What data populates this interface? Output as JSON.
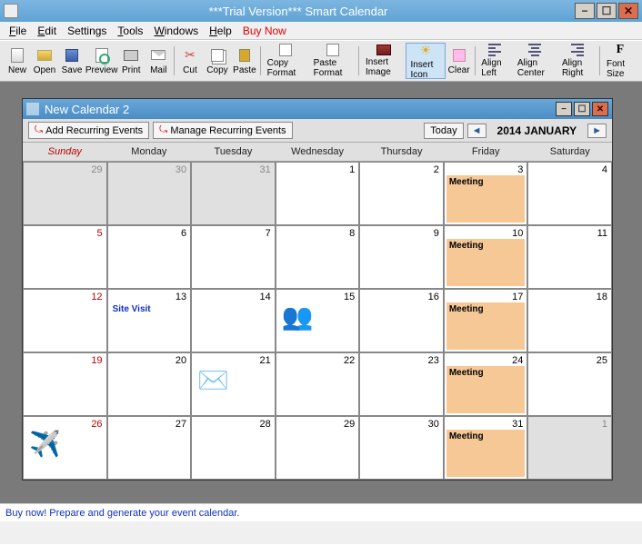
{
  "window": {
    "title": "***Trial Version*** Smart Calendar",
    "min": "−",
    "max": "☐",
    "close": "✕"
  },
  "menu": {
    "file": "File",
    "edit": "Edit",
    "settings": "Settings",
    "tools": "Tools",
    "windows": "Windows",
    "help": "Help",
    "buy": "Buy Now"
  },
  "toolbar": {
    "new": "New",
    "open": "Open",
    "save": "Save",
    "preview": "Preview",
    "print": "Print",
    "mail": "Mail",
    "cut": "Cut",
    "copy": "Copy",
    "paste": "Paste",
    "copyf": "Copy Format",
    "pastef": "Paste Format",
    "insimg": "Insert Image",
    "insicon": "Insert Icon",
    "clear": "Clear",
    "aleft": "Align Left",
    "acenter": "Align Center",
    "aright": "Align Right",
    "fsize": "Font Size"
  },
  "doc": {
    "title": "New Calendar 2",
    "min": "−",
    "max": "☐",
    "close": "✕"
  },
  "cal": {
    "addrec": "Add Recurring Events",
    "managerec": "Manage Recurring Events",
    "today": "Today",
    "prev": "◄",
    "next": "►",
    "month": "2014 JANUARY",
    "days": {
      "sun": "Sunday",
      "mon": "Monday",
      "tue": "Tuesday",
      "wed": "Wednesday",
      "thu": "Thursday",
      "fri": "Friday",
      "sat": "Saturday"
    }
  },
  "grid": [
    [
      {
        "n": "29",
        "out": true,
        "sun": true
      },
      {
        "n": "30",
        "out": true
      },
      {
        "n": "31",
        "out": true
      },
      {
        "n": "1"
      },
      {
        "n": "2"
      },
      {
        "n": "3",
        "ev": "Meeting",
        "evtype": "meeting"
      },
      {
        "n": "4"
      }
    ],
    [
      {
        "n": "5",
        "sun": true
      },
      {
        "n": "6"
      },
      {
        "n": "7"
      },
      {
        "n": "8"
      },
      {
        "n": "9"
      },
      {
        "n": "10",
        "ev": "Meeting",
        "evtype": "meeting"
      },
      {
        "n": "11"
      }
    ],
    [
      {
        "n": "12",
        "sun": true
      },
      {
        "n": "13",
        "ev": "Site Visit",
        "evtype": "sitevisit"
      },
      {
        "n": "14"
      },
      {
        "n": "15",
        "icon": "people-icon",
        "glyph": "👥"
      },
      {
        "n": "16"
      },
      {
        "n": "17",
        "ev": "Meeting",
        "evtype": "meeting"
      },
      {
        "n": "18"
      }
    ],
    [
      {
        "n": "19",
        "sun": true
      },
      {
        "n": "20"
      },
      {
        "n": "21",
        "icon": "envelope-icon",
        "glyph": "✉️"
      },
      {
        "n": "22"
      },
      {
        "n": "23"
      },
      {
        "n": "24",
        "ev": "Meeting",
        "evtype": "meeting"
      },
      {
        "n": "25"
      }
    ],
    [
      {
        "n": "26",
        "sun": true,
        "icon": "airplane-icon",
        "glyph": "✈️"
      },
      {
        "n": "27"
      },
      {
        "n": "28"
      },
      {
        "n": "29"
      },
      {
        "n": "30"
      },
      {
        "n": "31",
        "ev": "Meeting",
        "evtype": "meeting"
      },
      {
        "n": "1",
        "out": true
      }
    ]
  ],
  "footer": {
    "buy": "Buy now! Prepare and generate your event calendar."
  }
}
